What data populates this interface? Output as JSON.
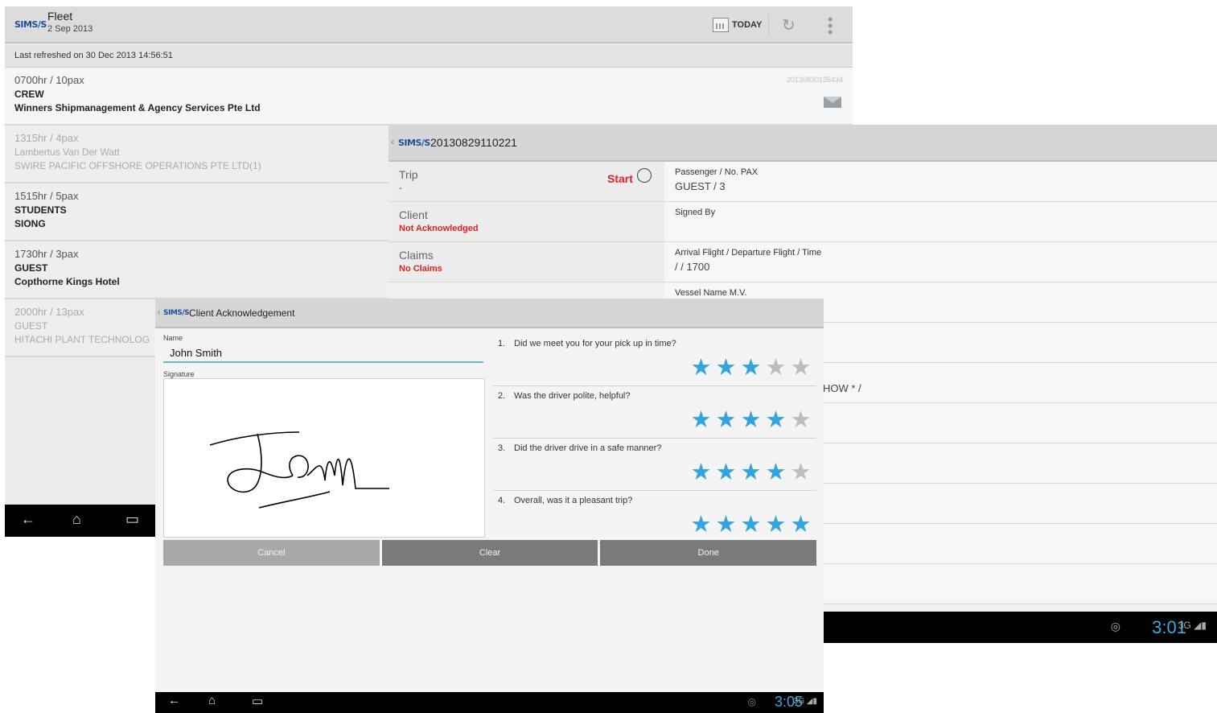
{
  "fleet": {
    "logo": "SIMS/S",
    "title": "Fleet",
    "date": "2 Sep 2013",
    "today_label": "TODAY",
    "last_refreshed": "Last refreshed on 30 Dec 2013 14:56:51",
    "jobs": [
      {
        "time": "0700hr / 10pax",
        "type": "CREW",
        "client": "Winners Shipmanagement & Agency Services Pte Ltd",
        "ref": "20130830135434"
      },
      {
        "time": "1315hr / 4pax",
        "type": "Lambertus Van Der Watt",
        "client": "SWIRE PACIFIC OFFSHORE OPERATIONS PTE LTD(1)"
      },
      {
        "time": "1515hr / 5pax",
        "type": "STUDENTS",
        "client": "SIONG"
      },
      {
        "time": "1730hr / 3pax",
        "type": "GUEST",
        "client": "Copthorne Kings Hotel"
      },
      {
        "time": "2000hr / 13pax",
        "type": "GUEST",
        "client": "HITACHI PLANT TECHNOLOG"
      }
    ]
  },
  "detail": {
    "logo": "SIMS/S",
    "title": "20130829110221",
    "trip": {
      "label": "Trip",
      "value": "-",
      "start_label": "Start"
    },
    "client": {
      "label": "Client",
      "value": "Not Acknowledged"
    },
    "claims": {
      "label": "Claims",
      "value": "No Claims"
    },
    "passenger": {
      "label": "Passenger / No. PAX",
      "value": "GUEST / 3"
    },
    "signed_by": {
      "label": "Signed By",
      "value": ""
    },
    "arrival": {
      "label": "Arrival Flight / Departure Flight / Time",
      "value": " / / 1700"
    },
    "vessel": {
      "label": "Vessel Name M.V.",
      "value": ""
    },
    "partial_text": "HOW * /",
    "clock": "3:01",
    "network": "3G"
  },
  "ack": {
    "logo": "SIMS/S",
    "title": "Client Acknowledgement",
    "name_label": "Name",
    "name_value": "John Smith",
    "signature_label": "Signature",
    "questions": [
      {
        "num": "1.",
        "text": "Did we meet you for your pick up in time?",
        "rating": 3
      },
      {
        "num": "2.",
        "text": "Was the driver polite, helpful?",
        "rating": 4
      },
      {
        "num": "3.",
        "text": "Did the driver drive in a safe manner?",
        "rating": 4
      },
      {
        "num": "4.",
        "text": "Overall, was it a pleasant trip?",
        "rating": 5
      }
    ],
    "buttons": {
      "cancel": "Cancel",
      "clear": "Clear",
      "done": "Done"
    },
    "clock": "3:05",
    "network": "3G"
  },
  "colors": {
    "accent": "#33a5dc",
    "alert": "#e02020",
    "star_off": "#bdbdbd"
  },
  "icons": [
    "calendar-icon",
    "refresh-icon",
    "overflow-menu-icon",
    "mail-icon",
    "clock-icon",
    "back-nav-icon",
    "home-nav-icon",
    "recents-nav-icon",
    "gps-icon",
    "signal-icon",
    "battery-icon",
    "star-icon"
  ]
}
